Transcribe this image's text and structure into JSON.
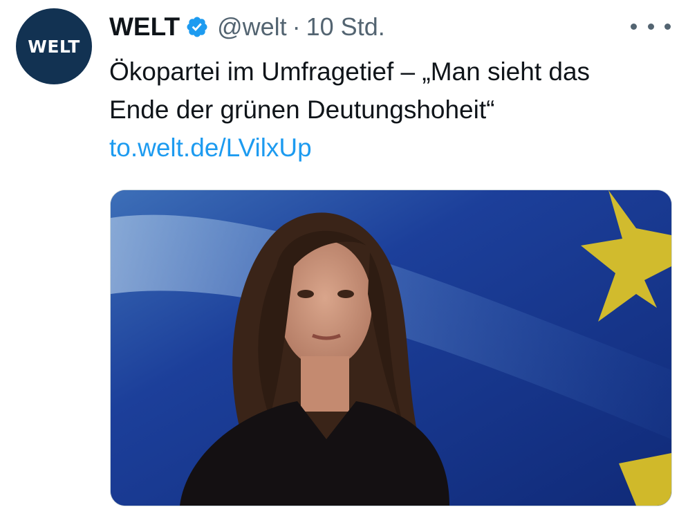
{
  "tweet": {
    "avatar_text": "WELT",
    "display_name": "WELT",
    "verified_icon": "verified-badge-icon",
    "handle": "@welt",
    "separator": "·",
    "timestamp": "10 Std.",
    "more_icon": "more-options-icon",
    "text_line1": "Ökopartei im Umfragetief – „Man sieht das",
    "text_line2": "Ende der grünen Deutungshoheit“",
    "link": "to.welt.de/LVilxUp",
    "media_description_icon": "photo-woman-eu-flag"
  },
  "colors": {
    "avatar_bg": "#123252",
    "verified": "#1d9bf0",
    "link": "#1d9bf0",
    "text": "#0f1419",
    "secondary": "#536471",
    "flag_blue": "#0f2b7a",
    "flag_star": "#f2d21c"
  }
}
